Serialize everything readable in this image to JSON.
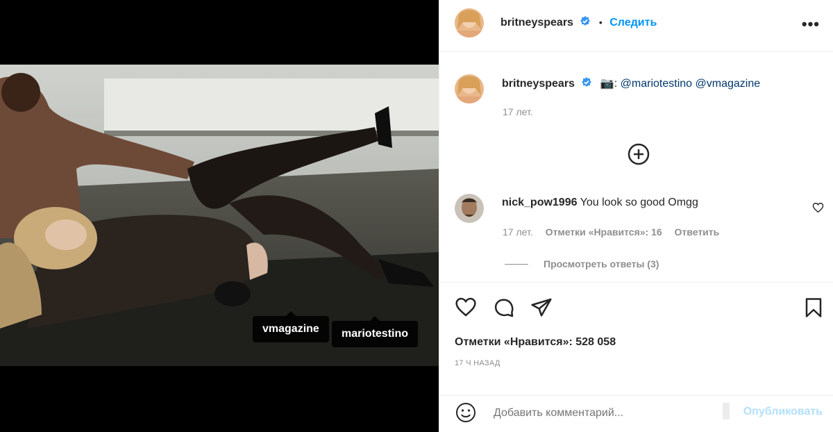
{
  "post": {
    "author": "britneyspears",
    "follow_label": "Следить",
    "separator": "•",
    "more_label": "•••"
  },
  "caption": {
    "author": "britneyspears",
    "camera_emoji": "📷",
    "colon": ":",
    "mention1": "@mariotestino",
    "mention2": "@vmagazine",
    "age": "17 лет."
  },
  "comment": {
    "author": "nick_pow1996",
    "text": "You look so good Omgg",
    "age": "17 лет.",
    "likes": "Отметки «Нравится»: 16",
    "reply_label": "Ответить",
    "view_replies": "Просмотреть ответы (3)"
  },
  "stats": {
    "likes": "Отметки «Нравится»: 528 058",
    "time": "17 Ч НАЗАД"
  },
  "tags": {
    "tag1": "vmagazine",
    "tag2": "mariotestino"
  },
  "add_comment": {
    "placeholder": "Добавить комментарий...",
    "publish_label": "Опубликовать"
  },
  "colors": {
    "accent": "#0095f6",
    "link": "#00376b",
    "muted": "#8e8e8e",
    "text": "#262626"
  },
  "icons": [
    "verified-icon",
    "more-icon",
    "add-circle-icon",
    "heart-icon",
    "comment-icon",
    "share-icon",
    "bookmark-icon",
    "emoji-icon",
    "user-tag-icon"
  ]
}
